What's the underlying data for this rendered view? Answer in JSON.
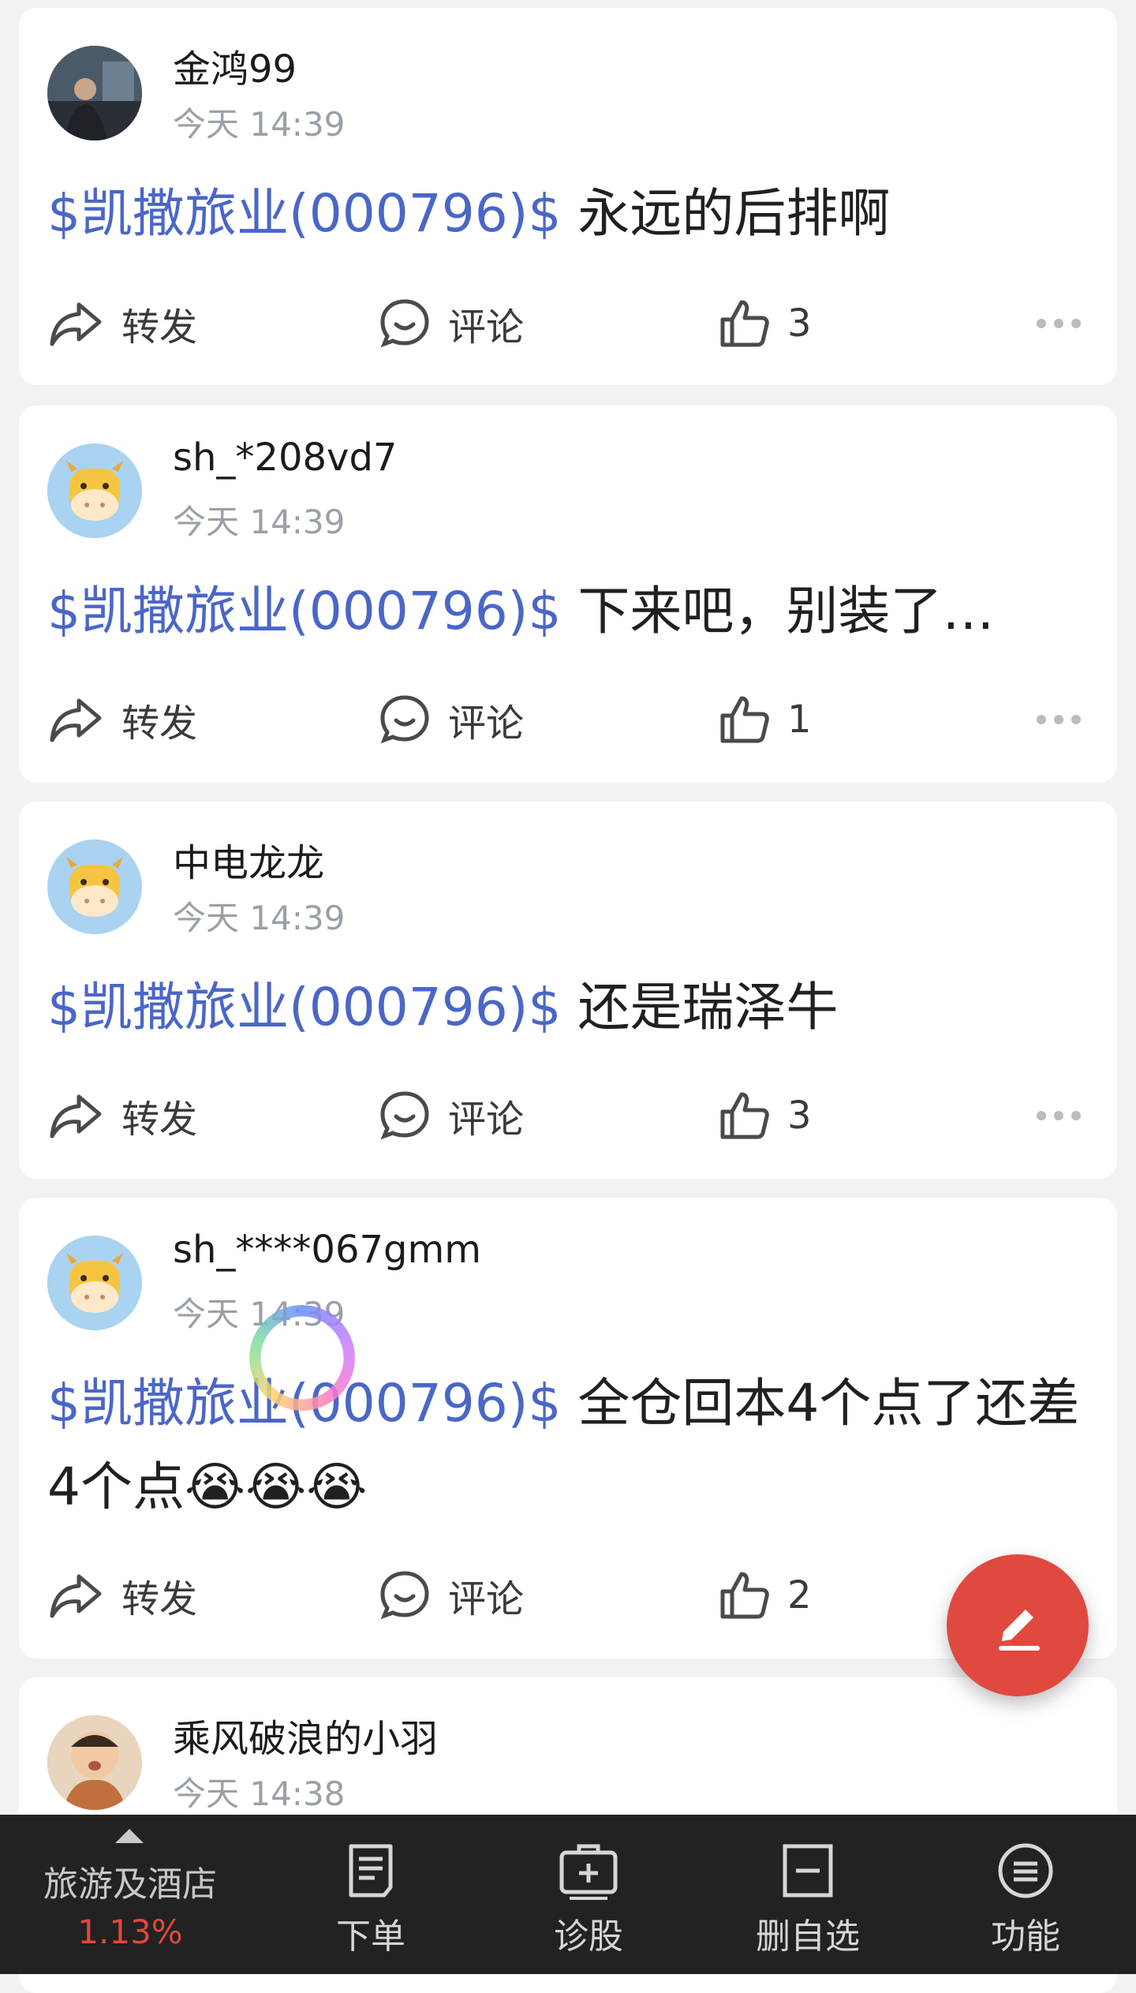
{
  "posts": [
    {
      "username": "金鸿99",
      "time": "今天 14:39",
      "stock": "$凯撒旅业(000796)$",
      "text": " 永远的后排啊",
      "text2": "",
      "avatar": "photo-avatar",
      "repost": "转发",
      "comment": "评论",
      "likes": "3"
    },
    {
      "username": "sh_*208vd7",
      "time": "今天 14:39",
      "stock": "$凯撒旅业(000796)$",
      "text": " 下来吧，别装了…",
      "text2": "",
      "avatar": "cow-avatar",
      "repost": "转发",
      "comment": "评论",
      "likes": "1"
    },
    {
      "username": "中电龙龙",
      "time": "今天 14:39",
      "stock": "$凯撒旅业(000796)$",
      "text": " 还是瑞泽牛",
      "text2": "",
      "avatar": "cow-avatar",
      "repost": "转发",
      "comment": "评论",
      "likes": "3"
    },
    {
      "username": "sh_****067gmm",
      "time": "今天 14:39",
      "stock": "$凯撒旅业(000796)$",
      "text": " 全仓回本4个点了还差",
      "text2": "4个点😭😭😭",
      "avatar": "cow-avatar",
      "repost": "转发",
      "comment": "评论",
      "likes": "2"
    },
    {
      "username": "乘风破浪的小羽",
      "time": "今天 14:38",
      "avatar": "photo-avatar"
    }
  ],
  "bottom_bar": {
    "sector_name": "旅游及酒店",
    "sector_change": "1.13%",
    "tabs": [
      {
        "label": "下单",
        "icon": "order-icon"
      },
      {
        "label": "诊股",
        "icon": "diagnose-icon"
      },
      {
        "label": "删自选",
        "icon": "remove-watchlist-icon"
      },
      {
        "label": "功能",
        "icon": "menu-icon"
      }
    ]
  },
  "colors": {
    "stock_link": "#4a66c8",
    "fab": "#e0493f",
    "change_up": "#e2473b"
  }
}
